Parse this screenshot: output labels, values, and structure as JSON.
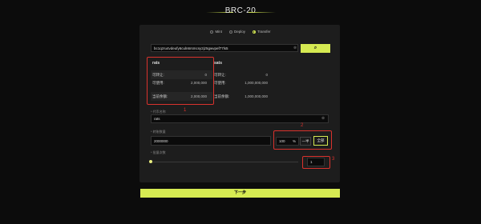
{
  "header": {
    "title": "BRC-20"
  },
  "modes": [
    {
      "label": "Mint",
      "active": false
    },
    {
      "label": "Deploy",
      "active": false
    },
    {
      "label": "Transfer",
      "active": true
    }
  ],
  "address": {
    "value": "bc1qzru4vdeufy6culn6rsmcsy2jz5gwvpef77ls5",
    "icon": "clear-icon",
    "search_icon": "search-icon"
  },
  "tabs": {
    "selected": "rats",
    "other": "sats"
  },
  "balances": {
    "left": [
      {
        "label": "可转让:",
        "value": "0"
      },
      {
        "label": "可使用:",
        "value": "2,000,000"
      },
      {
        "label": "当前余额:",
        "value": "2,000,000"
      }
    ],
    "right": [
      {
        "label": "可转让:",
        "value": "0"
      },
      {
        "label": "可使用:",
        "value": "1,000,000,000"
      },
      {
        "label": "当前余额:",
        "value": "1,000,000,000"
      }
    ]
  },
  "token": {
    "section_label": "代币名称",
    "value": "rats"
  },
  "amount": {
    "section_label": "转账数量",
    "value": "2000000",
    "percent_value": "100",
    "percent_unit": "%",
    "half_label": "一半",
    "all_label": "全部"
  },
  "batch": {
    "section_label": "批量次数",
    "value": "1"
  },
  "annotations": [
    "1",
    "2",
    "3"
  ],
  "next_label": "下一步",
  "colors": {
    "accent": "#d6ea52",
    "annotation": "#d9322d",
    "panel": "#1d1d1d",
    "background": "#0c0c0c"
  }
}
